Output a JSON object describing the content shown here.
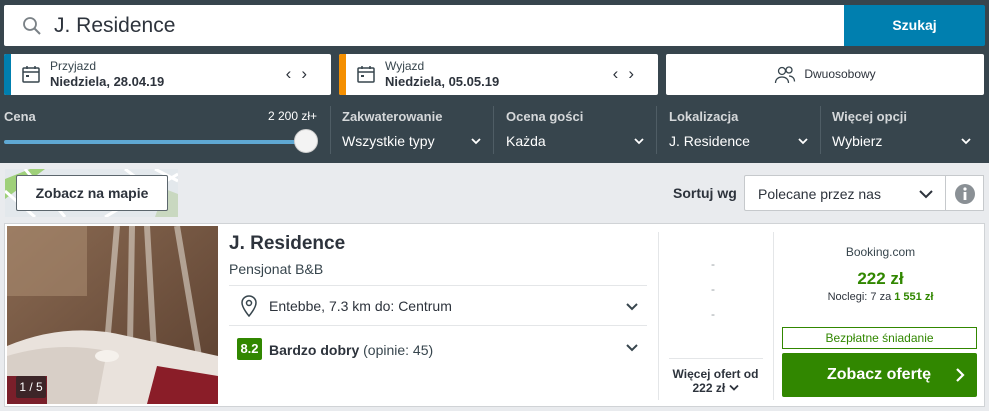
{
  "search": {
    "value": "J. Residence",
    "button_label": "Szukaj"
  },
  "dates": {
    "checkin": {
      "label": "Przyjazd",
      "value": "Niedziela, 28.04.19"
    },
    "checkout": {
      "label": "Wyjazd",
      "value": "Niedziela, 05.05.19"
    }
  },
  "room": {
    "label": "Dwuosobowy"
  },
  "filters": {
    "price": {
      "label": "Cena",
      "max_label": "2 200 zł+",
      "slider_level": 1.0
    },
    "accommodation": {
      "label": "Zakwaterowanie",
      "value": "Wszystkie typy"
    },
    "rating": {
      "label": "Ocena gości",
      "value": "Każda"
    },
    "location": {
      "label": "Lokalizacja",
      "value": "J. Residence"
    },
    "more": {
      "label": "Więcej opcji",
      "value": "Wybierz"
    }
  },
  "map_button": "Zobacz na mapie",
  "sort": {
    "label": "Sortuj wg",
    "value": "Polecane przez nas"
  },
  "result": {
    "name": "J. Residence",
    "type": "Pensjonat B&B",
    "photo_counter": "1 / 5",
    "location": "Entebbe, 7.3 km do: Centrum",
    "rating_score": "8.2",
    "rating_text": "Bardzo dobry",
    "rating_count": "(opinie: 45)",
    "placeholder_dash": "-",
    "more_offers_label": "Więcej ofert od",
    "more_offers_price": "222 zł",
    "provider": "Booking.com",
    "price": "222 zł",
    "nights_label": "Noclegi: 7 za",
    "nights_total": "1 551 zł",
    "breakfast": "Bezpłatne śniadanie",
    "cta_label": "Zobacz ofertę"
  },
  "colors": {
    "topbar": "#37454d",
    "search_button": "#007faf",
    "checkin_stripe": "#007faf",
    "checkout_stripe": "#f48f00",
    "deal_green": "#318700"
  }
}
